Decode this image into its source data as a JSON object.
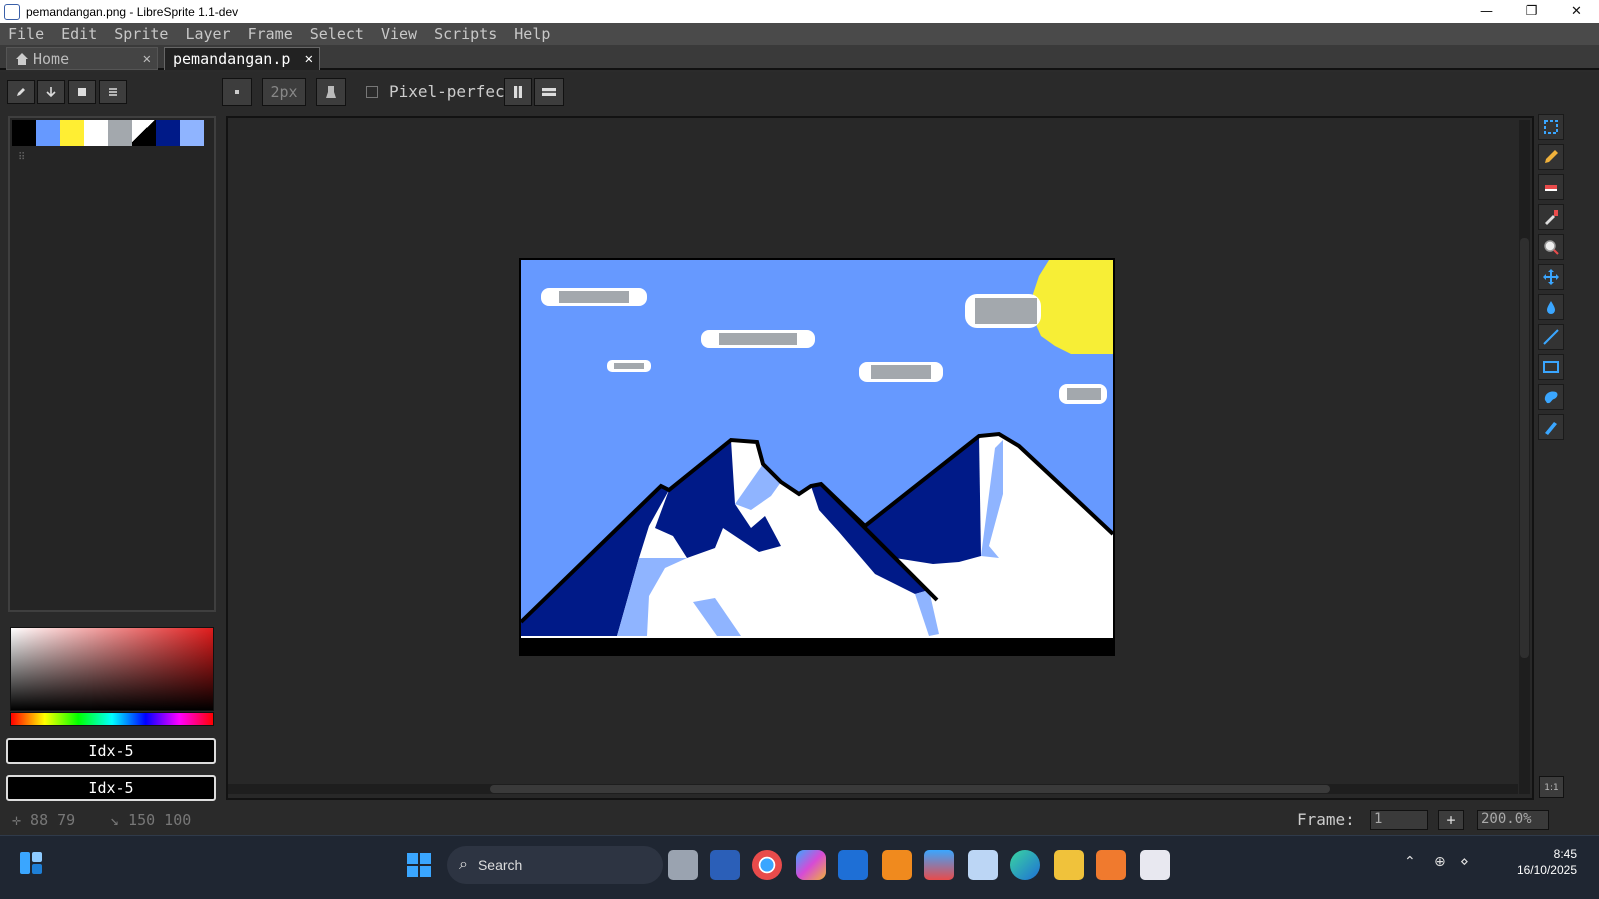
{
  "window": {
    "title": "pemandangan.png - LibreSprite 1.1-dev",
    "minimize": "—",
    "maximize": "❐",
    "close": "✕"
  },
  "menu": [
    "File",
    "Edit",
    "Sprite",
    "Layer",
    "Frame",
    "Select",
    "View",
    "Scripts",
    "Help"
  ],
  "tabs": {
    "home": "Home",
    "active": "pemandangan.p",
    "close": "✕"
  },
  "toolbar_options": {
    "brush_size": "2px",
    "pixel_perfect": "Pixel-perfect"
  },
  "palette": {
    "colors": [
      "#000000",
      "#6699ff",
      "#ffee33",
      "#ffffff",
      "#a3a8ad",
      "#000000",
      "#001a88",
      "#8fb4ff"
    ],
    "grip": "⠿"
  },
  "color_boxes": {
    "fg": "Idx-5",
    "bg": "Idx-5"
  },
  "tools": [
    "marquee-icon",
    "pencil-icon",
    "eraser-icon",
    "eyedropper-icon",
    "zoom-icon",
    "move-icon",
    "fill-icon",
    "line-icon",
    "rectangle-icon",
    "blob-icon",
    "blur-icon"
  ],
  "zoom_reset": "1:1",
  "status": {
    "cursor": "✛ 88 79",
    "size": "↘ 150 100",
    "frame_label": "Frame:",
    "frame_value": "1",
    "add_frame": "+",
    "zoom": "200.0%"
  },
  "taskbar": {
    "search": "Search",
    "time": "8:45",
    "date": "16/10/2025"
  }
}
